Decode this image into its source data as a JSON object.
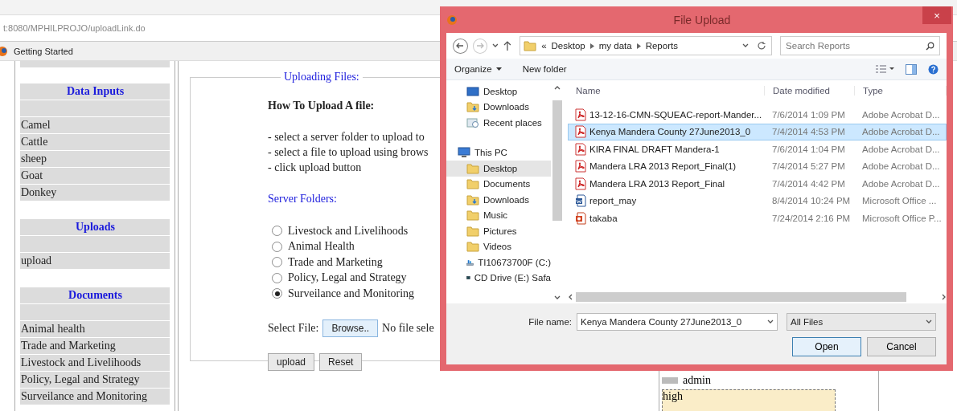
{
  "browser": {
    "address": "t:8080/MPHILPROJO/uploadLink.do",
    "bookmarks": [
      "Getting Started"
    ]
  },
  "sidebar": {
    "sections": [
      {
        "title": "Data Inputs",
        "items": [
          "Camel",
          "Cattle",
          "sheep",
          "Goat",
          "Donkey"
        ]
      },
      {
        "title": "Uploads",
        "items": [
          "upload"
        ]
      },
      {
        "title": "Documents",
        "items": [
          "Animal health",
          "Trade and Marketing",
          "Livestock and Livelihoods",
          "Policy, Legal and Strategy",
          "Surveilance and Monitoring"
        ]
      }
    ]
  },
  "main": {
    "legend": "Uploading Files:",
    "heading": "How To Upload A file:",
    "instructions": [
      "- select a server folder to upload to",
      "- select a file to upload using brows",
      "- click upload button"
    ],
    "folders_label": "Server Folders:",
    "folders": [
      {
        "label": "Livestock and Livelihoods",
        "selected": false
      },
      {
        "label": "Animal Health",
        "selected": false
      },
      {
        "label": "Trade and Marketing",
        "selected": false
      },
      {
        "label": "Policy, Legal and Strategy",
        "selected": false
      },
      {
        "label": "Surveilance and Monitoring",
        "selected": true
      }
    ],
    "select_file_label": "Select File:",
    "browse": "Browse..",
    "file_status": "No file sele",
    "buttons": [
      "upload",
      "Reset"
    ]
  },
  "right_panel": {
    "user": "admin",
    "note": "high"
  },
  "dialog": {
    "title": "File Upload",
    "close": "×",
    "path": [
      "Desktop",
      "my data",
      "Reports"
    ],
    "path_prefix": "«",
    "search": {
      "placeholder": "Search Reports"
    },
    "toolbar": [
      {
        "label": "Organize",
        "dropdown": true
      },
      {
        "label": "New folder",
        "dropdown": false
      }
    ],
    "nav": [
      {
        "label": "Desktop",
        "kind": "desktop",
        "selected": false
      },
      {
        "label": "Downloads",
        "kind": "download",
        "selected": false
      },
      {
        "label": "Recent places",
        "kind": "recent",
        "selected": false
      },
      {
        "label": "This PC",
        "kind": "pc",
        "selected": false,
        "children": [
          {
            "label": "Desktop",
            "kind": "folder",
            "selected": true
          },
          {
            "label": "Documents",
            "kind": "folder",
            "selected": false
          },
          {
            "label": "Downloads",
            "kind": "download",
            "selected": false
          },
          {
            "label": "Music",
            "kind": "folder",
            "selected": false
          },
          {
            "label": "Pictures",
            "kind": "folder",
            "selected": false
          },
          {
            "label": "Videos",
            "kind": "folder",
            "selected": false
          },
          {
            "label": "TI10673700F (C:)",
            "kind": "drive",
            "selected": false
          },
          {
            "label": "CD Drive (E:) Safa",
            "kind": "cd",
            "selected": false
          }
        ]
      }
    ],
    "columns": [
      "Name",
      "Date modified",
      "Type"
    ],
    "files": [
      {
        "name": "13-12-16-CMN-SQUEAC-report-Mander...",
        "date": "7/6/2014 1:09 PM",
        "type": "Adobe Acrobat D...",
        "kind": "pdf",
        "selected": false
      },
      {
        "name": "Kenya Mandera County 27June2013_0",
        "date": "7/4/2014 4:53 PM",
        "type": "Adobe Acrobat D...",
        "kind": "pdf",
        "selected": true
      },
      {
        "name": "KIRA FINAL DRAFT Mandera-1",
        "date": "7/6/2014 1:04 PM",
        "type": "Adobe Acrobat D...",
        "kind": "pdf",
        "selected": false
      },
      {
        "name": "Mandera LRA 2013 Report_Final(1)",
        "date": "7/4/2014 5:27 PM",
        "type": "Adobe Acrobat D...",
        "kind": "pdf",
        "selected": false
      },
      {
        "name": "Mandera LRA 2013 Report_Final",
        "date": "7/4/2014 4:42 PM",
        "type": "Adobe Acrobat D...",
        "kind": "pdf",
        "selected": false
      },
      {
        "name": "report_may",
        "date": "8/4/2014 10:24 PM",
        "type": "Microsoft Office ...",
        "kind": "word",
        "selected": false
      },
      {
        "name": "takaba",
        "date": "7/24/2014 2:16 PM",
        "type": "Microsoft Office P...",
        "kind": "ppt",
        "selected": false
      }
    ],
    "filename_label": "File name:",
    "filename": "Kenya Mandera County 27June2013_0",
    "filter": "All Files",
    "buttons": [
      "Open",
      "Cancel"
    ]
  }
}
